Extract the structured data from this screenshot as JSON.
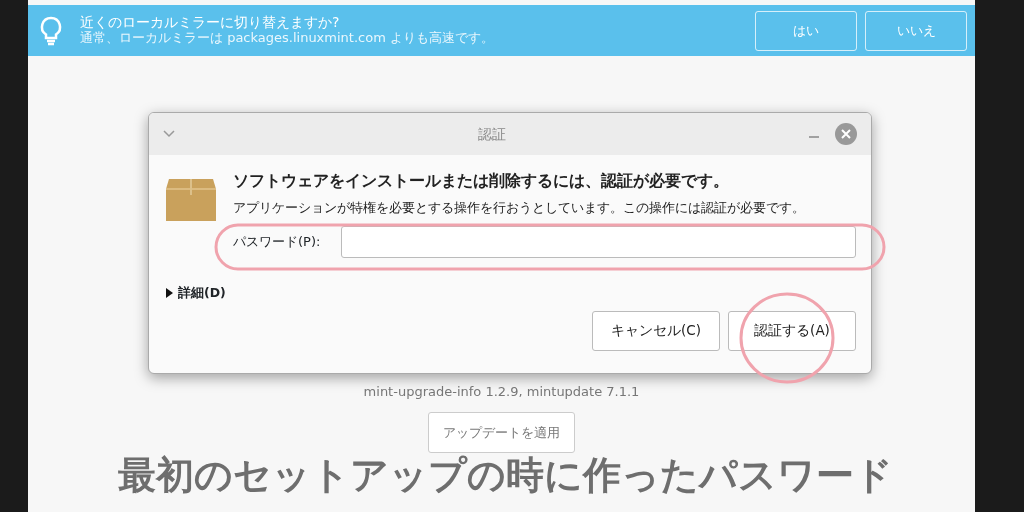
{
  "infobar": {
    "title": "近くのローカルミラーに切り替えますか?",
    "message": "通常、ローカルミラーは packages.linuxmint.com よりも高速です。",
    "buttons": [
      "はい",
      "いいえ"
    ]
  },
  "background": {
    "version_text": "mint-upgrade-info 1.2.9, mintupdate 7.1.1",
    "apply_button": "アップデートを適用"
  },
  "dialog": {
    "title": "認証",
    "heading": "ソフトウェアをインストールまたは削除するには、認証が必要です。",
    "message": "アプリケーションが特権を必要とする操作を行おうとしています。この操作には認証が必要です。",
    "password_label": "パスワード(P):",
    "details": {
      "label": "詳細(D)",
      "expanded": false
    },
    "buttons": [
      "キャンセル(C)",
      "認証する(A)"
    ]
  },
  "caption": "最初のセットアップの時に作ったパスワード"
}
